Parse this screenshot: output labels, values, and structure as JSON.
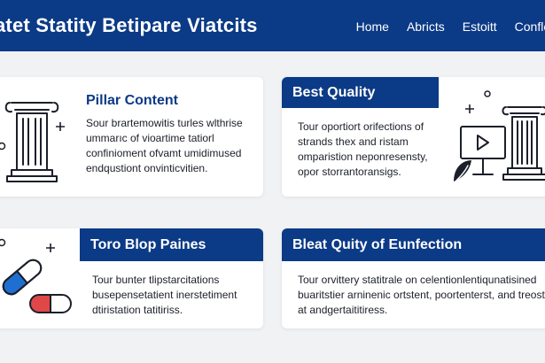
{
  "header": {
    "site_title": "atet Statity Betipare Viatcits",
    "nav": [
      "Home",
      "Abricts",
      "Estoitt",
      "Conflet"
    ]
  },
  "cards": [
    {
      "title": "Pillar Content",
      "lines": [
        "Sour brartemowitis turles wlthrise",
        "ummarıc of vioartime tatiorl",
        "confinioment ofvamt umidimused",
        "endqustiont onvinticvitien."
      ]
    },
    {
      "title": "Best Quality",
      "lines": [
        "Tour oportiort orifections of",
        "strands thex and ristam",
        "omparistion neponresensty,",
        "opor storrantoransigs."
      ]
    },
    {
      "title": "Toro Blop Paines",
      "lines": [
        "Tour bunter tlipstarcitations",
        "busepensetatient inerstetiment",
        "dtiristation tatitiriss."
      ]
    },
    {
      "title": "Bleat Quity of Eunfection",
      "lines": [
        "Tour orvittery statitrale on celentionlentiqunatisined",
        "buaritstier arninenic ortstent, poortenterst, and treost",
        "at andgertaititiress."
      ]
    }
  ],
  "colors": {
    "primary": "#0b3a86",
    "background": "#f1f2f4",
    "card": "#ffffff",
    "pill_blue": "#1f6fd1",
    "pill_red": "#e04848"
  },
  "icons": [
    "pillar-icon",
    "pillar-icon",
    "video-monitor-icon",
    "leaf-icon",
    "capsule-icon",
    "plus-icon",
    "sparkle-icon"
  ]
}
